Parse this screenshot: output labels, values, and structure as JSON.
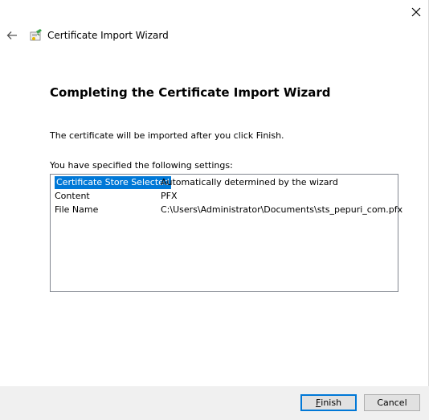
{
  "window": {
    "title": "Certificate Import Wizard"
  },
  "page": {
    "heading": "Completing the Certificate Import Wizard",
    "intro": "The certificate will be imported after you click Finish.",
    "settings_label": "You have specified the following settings:"
  },
  "settings": [
    {
      "key": "Certificate Store Selected",
      "value": "Automatically determined by the wizard",
      "selected": true
    },
    {
      "key": "Content",
      "value": "PFX"
    },
    {
      "key": "File Name",
      "value": "C:\\Users\\Administrator\\Documents\\sts_pepuri_com.pfx"
    }
  ],
  "buttons": {
    "finish_mnemonic": "F",
    "finish_rest": "inish",
    "cancel": "Cancel"
  },
  "colors": {
    "selection": "#0078d7",
    "footer": "#f0f0f0"
  }
}
